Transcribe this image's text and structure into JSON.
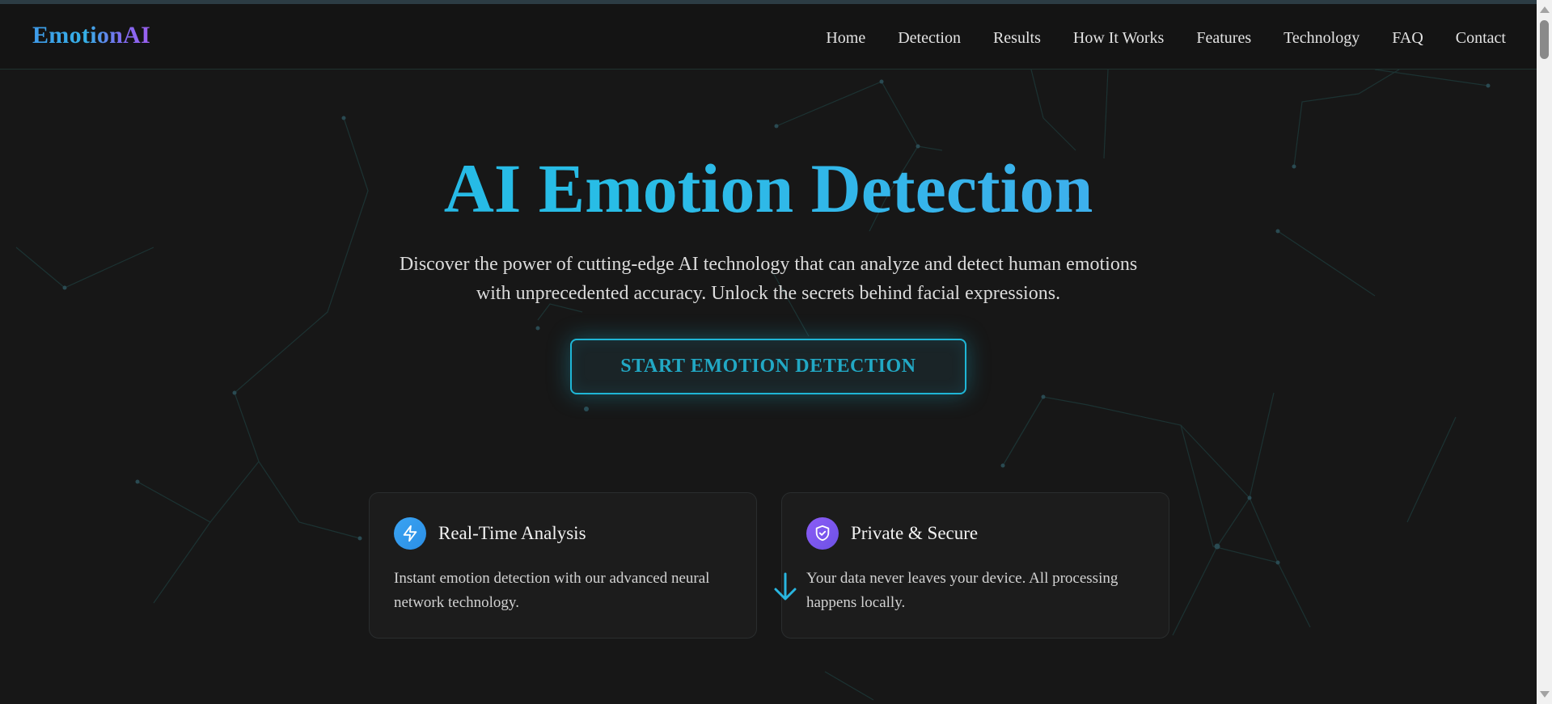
{
  "brand": {
    "logo_text": "EmotionAI"
  },
  "nav": {
    "items": [
      {
        "label": "Home"
      },
      {
        "label": "Detection"
      },
      {
        "label": "Results"
      },
      {
        "label": "How It Works"
      },
      {
        "label": "Features"
      },
      {
        "label": "Technology"
      },
      {
        "label": "FAQ"
      },
      {
        "label": "Contact"
      }
    ]
  },
  "hero": {
    "title": "AI Emotion Detection",
    "subtitle_line1": "Discover the power of cutting-edge AI technology that can analyze and detect human emotions",
    "subtitle_line2": "with unprecedented accuracy. Unlock the secrets behind facial expressions.",
    "cta_label": "START EMOTION DETECTION"
  },
  "cards": [
    {
      "icon": "lightning-icon",
      "title": "Real-Time Analysis",
      "text_line1": "Instant emotion detection with our advanced neural",
      "text_line2": "network technology."
    },
    {
      "icon": "shield-check-icon",
      "title": "Private & Secure",
      "text_line1": "Your data never leaves your device. All processing",
      "text_line2": "happens locally."
    }
  ],
  "colors": {
    "background": "#171717",
    "accent_cyan": "#22b3e4",
    "accent_purple": "#8b5cf6",
    "cta_border": "#1fb6d6"
  },
  "scroll_indicator_icon": "arrow-down-icon"
}
